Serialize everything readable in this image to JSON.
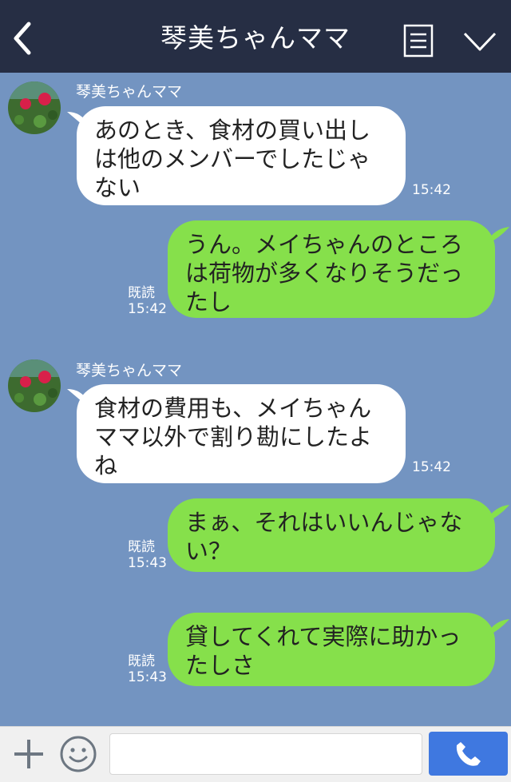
{
  "header": {
    "title": "琴美ちゃんママ",
    "back_icon": "chevron-left-icon",
    "menu_icon": "list-menu-icon",
    "collapse_icon": "chevron-down-icon"
  },
  "colors": {
    "header_bg": "#262e44",
    "chat_bg": "#7394c1",
    "incoming_bubble": "#ffffff",
    "outgoing_bubble": "#86e04b",
    "call_button": "#3f78e0"
  },
  "messages": [
    {
      "direction": "incoming",
      "sender": "琴美ちゃんママ",
      "lines": [
        "あのとき、食材の買い出し",
        "は他のメンバーでしたじゃ",
        "ない"
      ],
      "time": "15:42"
    },
    {
      "direction": "outgoing",
      "lines": [
        "うん。メイちゃんのところ",
        "は荷物が多くなりそうだっ",
        "たし"
      ],
      "read": "既読",
      "time": "15:42"
    },
    {
      "direction": "incoming",
      "sender": "琴美ちゃんママ",
      "lines": [
        "食材の費用も、メイちゃん",
        "ママ以外で割り勘にしたよ",
        "ね"
      ],
      "time": "15:42"
    },
    {
      "direction": "outgoing",
      "lines": [
        "まぁ、それはいいんじゃな",
        "い？"
      ],
      "read": "既読",
      "time": "15:43"
    },
    {
      "direction": "outgoing",
      "lines": [
        "貸してくれて実際に助かっ",
        "たしさ"
      ],
      "read": "既読",
      "time": "15:43"
    }
  ],
  "footer": {
    "input_value": "",
    "plus_icon": "plus-icon",
    "emoji_icon": "smiley-icon",
    "call_icon": "phone-icon"
  }
}
